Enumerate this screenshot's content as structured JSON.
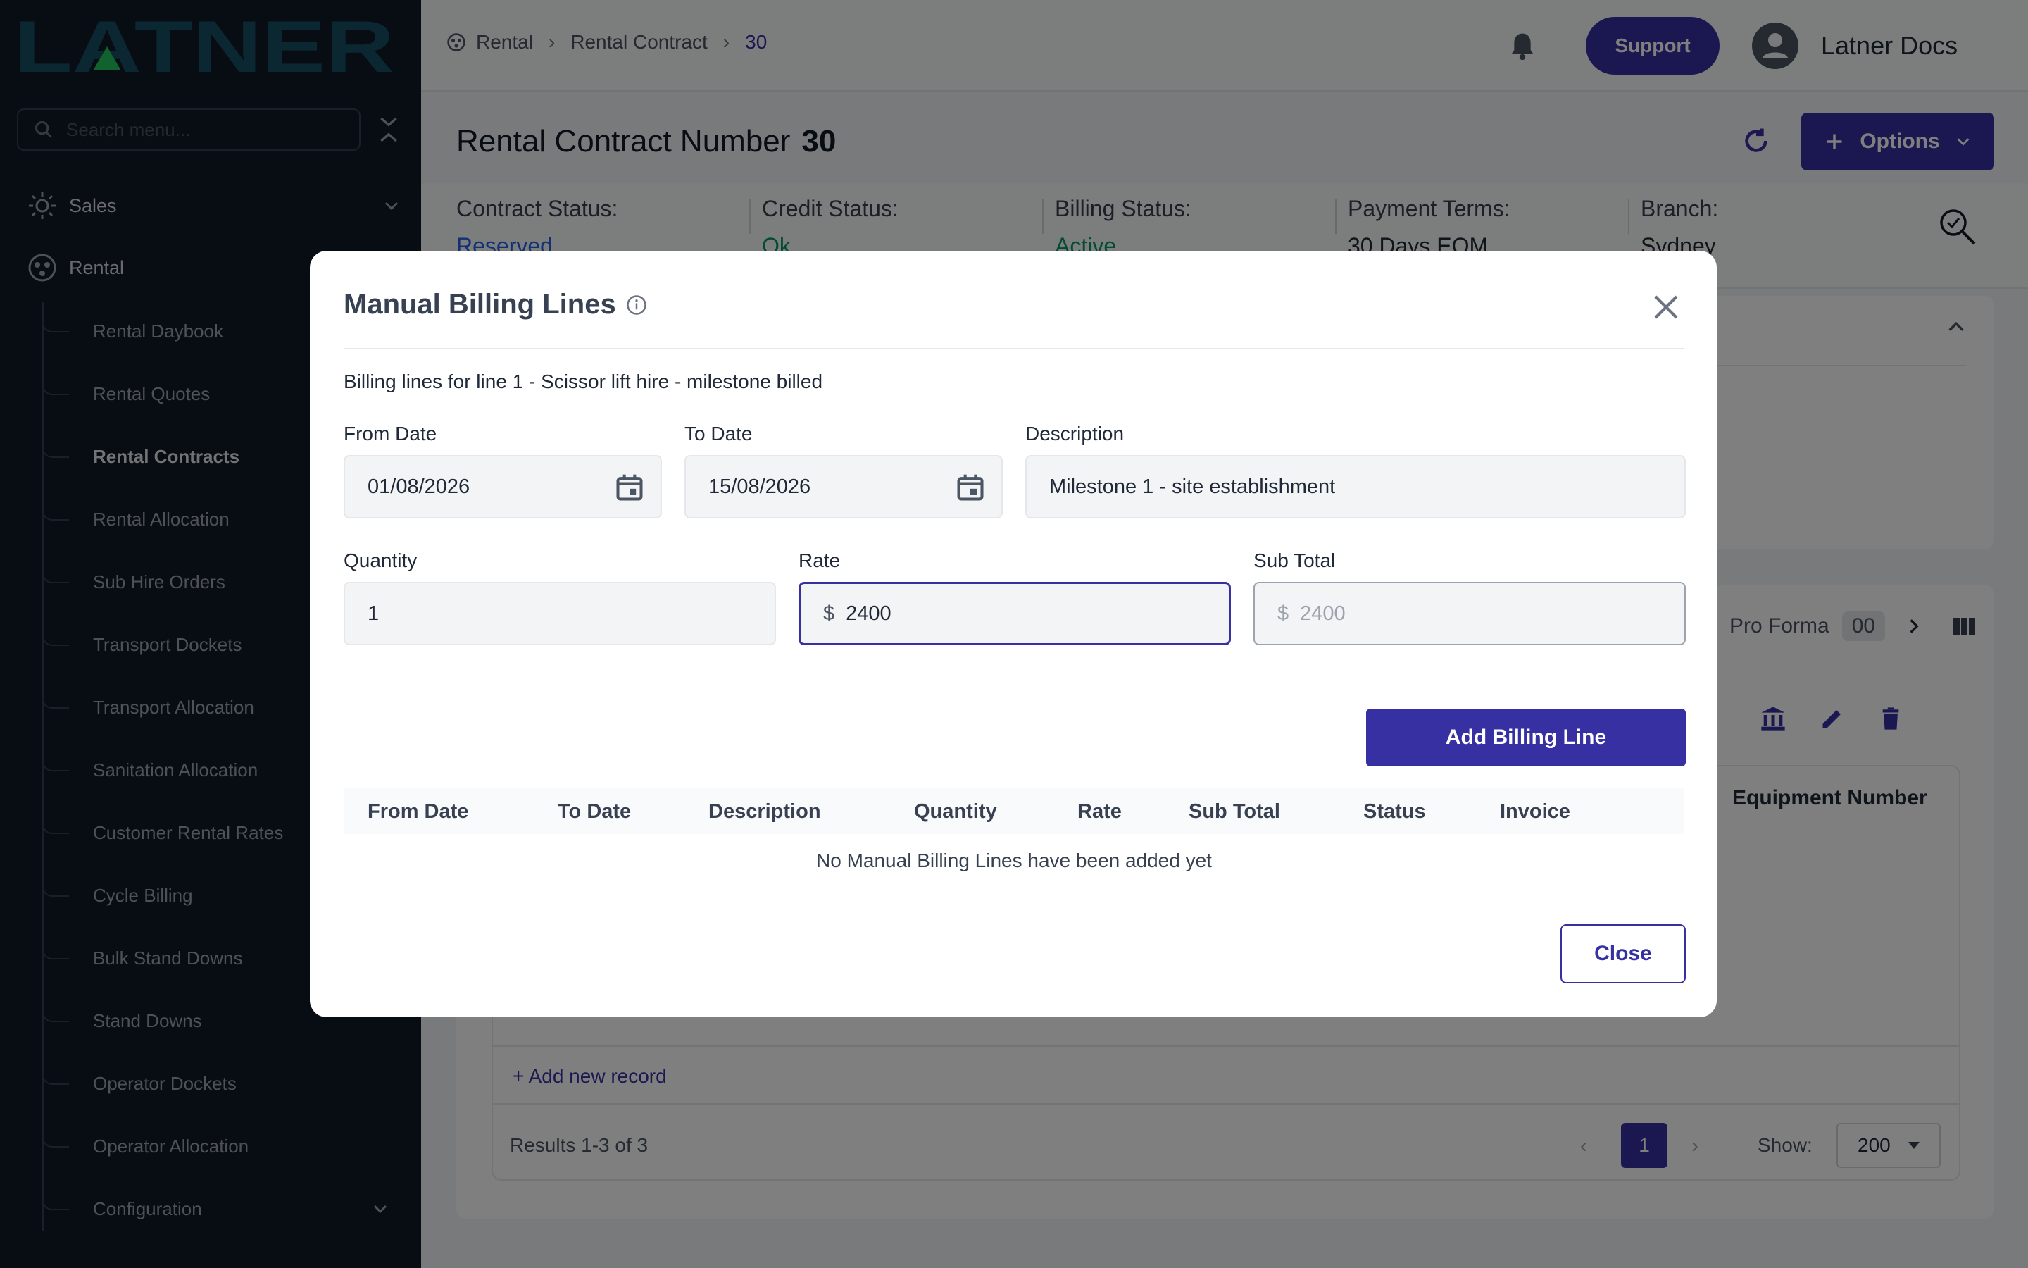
{
  "sidebar": {
    "logo_text": "LATNER",
    "search_placeholder": "Search menu...",
    "sales_label": "Sales",
    "rental_label": "Rental",
    "items": [
      {
        "label": "Rental Daybook"
      },
      {
        "label": "Rental Quotes"
      },
      {
        "label": "Rental Contracts"
      },
      {
        "label": "Rental Allocation"
      },
      {
        "label": "Sub Hire Orders"
      },
      {
        "label": "Transport Dockets"
      },
      {
        "label": "Transport Allocation"
      },
      {
        "label": "Sanitation Allocation"
      },
      {
        "label": "Customer Rental Rates"
      },
      {
        "label": "Cycle Billing"
      },
      {
        "label": "Bulk Stand Downs"
      },
      {
        "label": "Stand Downs"
      },
      {
        "label": "Operator Dockets"
      },
      {
        "label": "Operator Allocation"
      },
      {
        "label": "Configuration"
      }
    ]
  },
  "header": {
    "breadcrumb": [
      "Rental",
      "Rental Contract",
      "30"
    ],
    "support_label": "Support",
    "username": "Latner Docs"
  },
  "page": {
    "title": "Rental Contract Number",
    "number": "30",
    "options_label": "Options",
    "info": [
      {
        "label": "Contract Status:",
        "value": "Reserved",
        "color": "#2563eb"
      },
      {
        "label": "Credit Status:",
        "value": "Ok",
        "color": "#059669"
      },
      {
        "label": "Billing Status:",
        "value": "Active",
        "color": "#059669"
      },
      {
        "label": "Payment Terms:",
        "value": "30 Days EOM",
        "color": "#111827"
      },
      {
        "label": "Branch:",
        "value": "Sydney",
        "color": "#111827"
      }
    ],
    "pro_forma_label": "Pro Forma",
    "pro_forma_count": "00",
    "equipment_number_header": "Equipment Number",
    "add_record": "+ Add new record",
    "results_text": "Results 1-3 of 3",
    "current_page": "1",
    "show_label": "Show:",
    "show_value": "200"
  },
  "modal": {
    "title": "Manual Billing Lines",
    "subtitle": "Billing lines for line 1 - Scissor lift hire - milestone billed",
    "from_date_label": "From Date",
    "from_date_value": "01/08/2026",
    "to_date_label": "To Date",
    "to_date_value": "15/08/2026",
    "description_label": "Description",
    "description_value": "Milestone 1 - site establishment",
    "quantity_label": "Quantity",
    "quantity_value": "1",
    "rate_label": "Rate",
    "rate_value": "2400",
    "subtotal_label": "Sub Total",
    "subtotal_value": "2400",
    "currency_symbol": "$",
    "add_button": "Add Billing Line",
    "columns": [
      "From Date",
      "To Date",
      "Description",
      "Quantity",
      "Rate",
      "Sub Total",
      "Status",
      "Invoice"
    ],
    "empty_message": "No Manual Billing Lines have been added yet",
    "close_button": "Close"
  },
  "colors": {
    "accent": "#3730a3",
    "sidebar_bg": "#111827",
    "logo": "#164e63",
    "logo_accent": "#22c55e"
  }
}
